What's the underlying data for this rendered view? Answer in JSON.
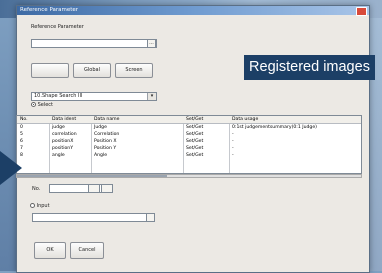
{
  "window": {
    "title": "Reference Parameter"
  },
  "reference_parameter": {
    "label": "Reference Parameter",
    "value": ""
  },
  "buttons": {
    "browse": "...",
    "blank": "",
    "global": "Global",
    "screen": "Screen",
    "ok": "OK",
    "cancel": "Cancel"
  },
  "unit_select": {
    "value": "10.Shape Search III"
  },
  "radio_select": {
    "label": "Select",
    "selected": true
  },
  "table": {
    "columns": [
      "No.",
      "Data ident",
      "Data name",
      "Set/Get",
      "Data usage"
    ],
    "rows": [
      [
        "0",
        "judge",
        "Judge",
        "Set/Get",
        "0:1st judgementsummary(0:1 Judge)"
      ],
      [
        "5",
        "correlation",
        "Correlation",
        "Set/Get",
        "-"
      ],
      [
        "6",
        "positionX",
        "Position X",
        "Set/Get",
        "-"
      ],
      [
        "7",
        "positionY",
        "Position Y",
        "Set/Get",
        "-"
      ],
      [
        "8",
        "angle",
        "Angle",
        "Set/Get",
        "-"
      ]
    ]
  },
  "no_field": {
    "label": "No."
  },
  "radio_input": {
    "label": "Input",
    "selected": false
  },
  "callout": {
    "text": "Registered images"
  },
  "colors": {
    "callout_bg": "#1c3f66",
    "titlebar": "#3d6aa4"
  }
}
